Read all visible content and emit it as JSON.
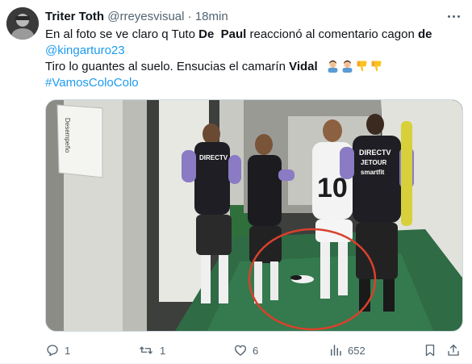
{
  "tweet": {
    "author_name": "Triter Toth",
    "author_handle": "@rreyesvisual",
    "separator": "·",
    "time": "18min",
    "text": {
      "line1_a": "En al foto se ve claro q Tuto ",
      "line1_b": "De",
      "line1_c": "  ",
      "line1_d": "Paul",
      "line1_e": " reaccionó al comentario cagon ",
      "line1_f": "de",
      "line2_mention": "@kingarturo23",
      "line3_a": "Tiro lo guantes al suelo. Ensucias el camarín ",
      "line3_b": "Vidal",
      "line4_hashtag": "#VamosColoColo"
    },
    "emojis": [
      "man-facepalming-icon",
      "man-facepalming-icon",
      "thumbs-down-icon",
      "thumbs-down-icon"
    ],
    "media": {
      "jersey_sponsor_1": "DIRECTV",
      "jersey_sponsor_2": "JETOUR",
      "jersey_sponsor_3": "smartfit",
      "wall_sign": "Desempeño",
      "player_number": "10",
      "highlight_color": "#d9412c"
    },
    "stats": {
      "replies": "1",
      "reposts": "1",
      "likes": "6",
      "views": "652"
    }
  },
  "colors": {
    "text": "#0f1419",
    "secondary": "#536471",
    "link": "#1d9bf0"
  }
}
